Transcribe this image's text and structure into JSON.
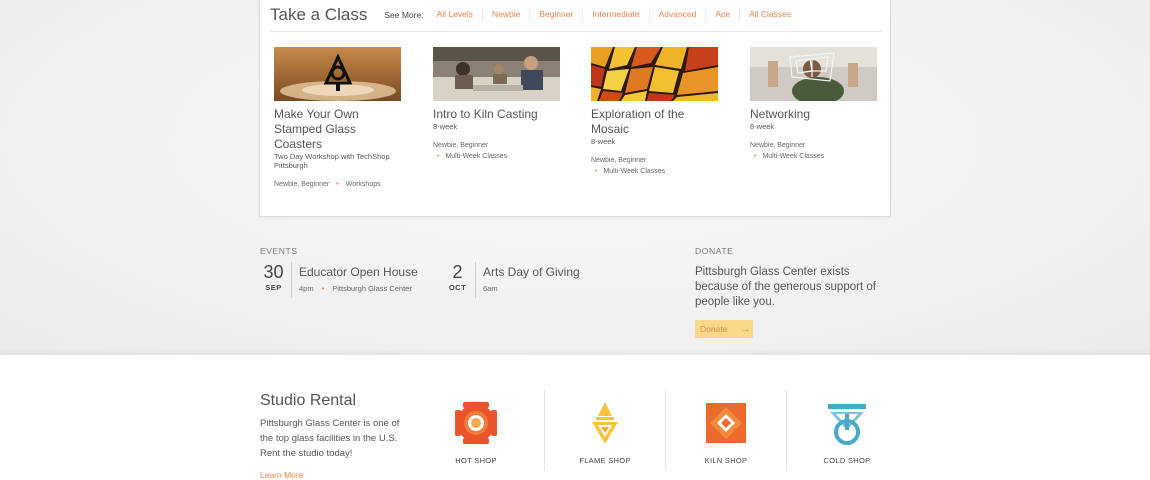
{
  "take_class": {
    "title": "Take a Class",
    "see_more": "See More:",
    "filters": [
      "All Levels",
      "Newbie",
      "Beginner",
      "Intermediate",
      "Advanced",
      "Ace",
      "All Classes"
    ],
    "classes": [
      {
        "name": "Make Your Own Stamped Glass Coasters",
        "sub": "Two Day Workshop with TechShop Pittsburgh",
        "levels": "Newbie, Beginner",
        "category": "Workshops"
      },
      {
        "name": "Intro to Kiln Casting",
        "sub": "8-week",
        "levels": "Newbie, Beginner",
        "category": "Multi-Week Classes"
      },
      {
        "name": "Exploration of the Mosaic",
        "sub": "8-week",
        "levels": "Newbie, Beginner",
        "category": "Multi-Week Classes"
      },
      {
        "name": "Networking",
        "sub": "8-week",
        "levels": "Newbie, Beginner",
        "category": "Multi-Week Classes"
      }
    ]
  },
  "events": {
    "label": "EVENTS",
    "items": [
      {
        "day": "30",
        "month": "SEP",
        "title": "Educator Open House",
        "time": "4pm",
        "location": "Pittsburgh Glass Center"
      },
      {
        "day": "2",
        "month": "OCT",
        "title": "Arts Day of Giving",
        "time": "6am"
      }
    ]
  },
  "donate": {
    "label": "DONATE",
    "text": "Pittsburgh Glass Center exists because of the generous support of people like you.",
    "button": "Donate"
  },
  "studio": {
    "title": "Studio Rental",
    "text": "Pittsburgh Glass Center is one of the top glass facilities in the U.S. Rent the studio today!",
    "learn_more": "Learn More",
    "shops": [
      {
        "label": "HOT SHOP",
        "icon": "hot-shop-icon"
      },
      {
        "label": "FLAME SHOP",
        "icon": "flame-shop-icon"
      },
      {
        "label": "KILN SHOP",
        "icon": "kiln-shop-icon"
      },
      {
        "label": "COLD SHOP",
        "icon": "cold-shop-icon"
      }
    ]
  },
  "colors": {
    "accent": "#e8854e",
    "donate_button": "#fcd98a",
    "hot": "#e9542a",
    "flame": "#f7c33a",
    "kiln": "#ee6a2c",
    "cold": "#4aa9c9"
  }
}
